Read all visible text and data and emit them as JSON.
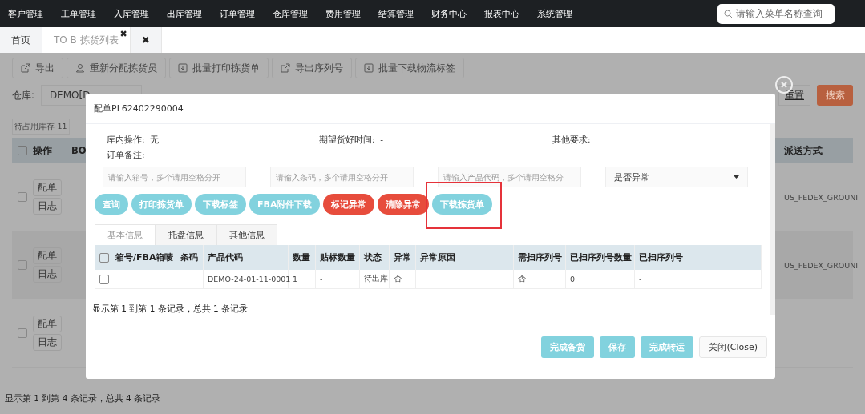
{
  "top_menu": [
    "客户管理",
    "工单管理",
    "入库管理",
    "出库管理",
    "订单管理",
    "仓库管理",
    "费用管理",
    "结算管理",
    "财务中心",
    "报表中心",
    "系统管理"
  ],
  "menu_search": {
    "placeholder": "请输入菜单名称查询"
  },
  "page_tabs": [
    {
      "label": "首页",
      "selected": false
    },
    {
      "label": "TO B 拣货列表",
      "selected": true,
      "close": "✖"
    },
    {
      "selected": false,
      "close": "✖"
    }
  ],
  "toolbar": [
    {
      "label": "导出",
      "kind": "export"
    },
    {
      "label": "重新分配拣货员",
      "kind": "user"
    },
    {
      "label": "批量打印拣货单",
      "kind": "download"
    },
    {
      "label": "导出序列号",
      "kind": "export"
    },
    {
      "label": "批量下载物流标签",
      "kind": "download"
    }
  ],
  "filter": {
    "label": "仓库:",
    "value": "DEMO[D",
    "reset": "重置",
    "search": "搜索"
  },
  "stat_tab": "待占用库存 11",
  "list": {
    "header_checked": false,
    "columns": [
      "操作",
      "BO",
      "派送方式"
    ],
    "rows": [
      {
        "checked": false,
        "actions": [
          "配单",
          "日志"
        ],
        "shipping": "US_FEDEX_GROUNI"
      },
      {
        "checked": false,
        "actions": [
          "配单",
          "日志"
        ],
        "shipping": "US_FEDEX_GROUNI"
      },
      {
        "checked": false,
        "actions": [
          "配单",
          "日志"
        ]
      }
    ],
    "footer": "显示第 1 到第 4 条记录，总共 4 条记录"
  },
  "modal": {
    "title": "配单PL62402290004",
    "info": [
      {
        "label": "库内操作:",
        "value": "无"
      },
      {
        "label": "期望货好时间:",
        "value": "-"
      },
      {
        "label": "其他要求:"
      }
    ],
    "remark_label": "订单备注:",
    "filters": [
      {
        "kind": "input",
        "placeholder": "请输入箱号，多个请用空格分开"
      },
      {
        "kind": "input",
        "placeholder": "请输入条码，多个请用空格分开"
      },
      {
        "kind": "input",
        "placeholder": "请输入产品代码，多个请用空格分"
      },
      {
        "kind": "select",
        "value": "是否异常"
      }
    ],
    "actions": [
      {
        "label": "查询",
        "kind": "info",
        "highlighted": false
      },
      {
        "label": "打印拣货单",
        "kind": "info",
        "highlighted": false
      },
      {
        "label": "下载标签",
        "kind": "info",
        "highlighted": false
      },
      {
        "label": "FBA附件下载",
        "kind": "info",
        "highlighted": false
      },
      {
        "label": "标记异常",
        "kind": "danger",
        "highlighted": false
      },
      {
        "label": "清除异常",
        "kind": "danger",
        "highlighted": false
      },
      {
        "label": "下载拣货单",
        "kind": "info",
        "highlighted": true
      }
    ],
    "tabs": [
      {
        "label": "基本信息",
        "selected": true
      },
      {
        "label": "托盘信息",
        "selected": false
      },
      {
        "label": "其他信息",
        "selected": false
      }
    ],
    "table": {
      "header_checked": false,
      "columns": [
        "箱号/FBA箱唛",
        "条码",
        "产品代码",
        "数量",
        "贴标数量",
        "状态",
        "异常",
        "异常原因",
        "需扫序列号",
        "已扫序列号数量",
        "已扫序列号"
      ],
      "rows": [
        {
          "checked": false,
          "cells": [
            "",
            "",
            "DEMO-24-01-11-0001",
            "1",
            "-",
            "待出库",
            "否",
            "",
            "否",
            "0",
            "-"
          ]
        }
      ]
    },
    "footer": "显示第 1 到第 1 条记录，总共 1 条记录",
    "buttons": [
      {
        "label": "完成备货",
        "kind": "primary"
      },
      {
        "label": "保存",
        "kind": "primary"
      },
      {
        "label": "完成转运",
        "kind": "primary"
      },
      {
        "label": "关闭(Close)",
        "kind": "default"
      }
    ]
  }
}
